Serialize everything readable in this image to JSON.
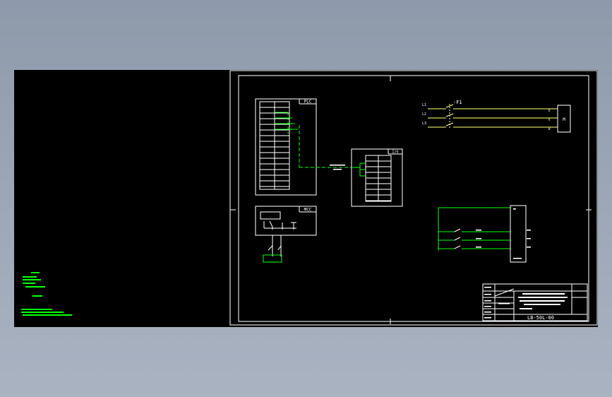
{
  "colors": {
    "background": "#8e9aab",
    "canvas": "#000000",
    "line_white": "#ffffff",
    "line_green": "#00ff00",
    "line_yellow": "#ffff66"
  },
  "plc_panel": {
    "title": "PLC"
  },
  "mcc_panel": {
    "title": "MCC"
  },
  "io_panel": {
    "title": "I/O"
  },
  "power": {
    "phases": [
      "L1",
      "L2",
      "L3"
    ],
    "breaker_label": "-F1",
    "terminals": [
      "U",
      "V",
      "W"
    ],
    "motor_label": "M"
  },
  "title_block": {
    "project_number": "LB-50L-00"
  }
}
